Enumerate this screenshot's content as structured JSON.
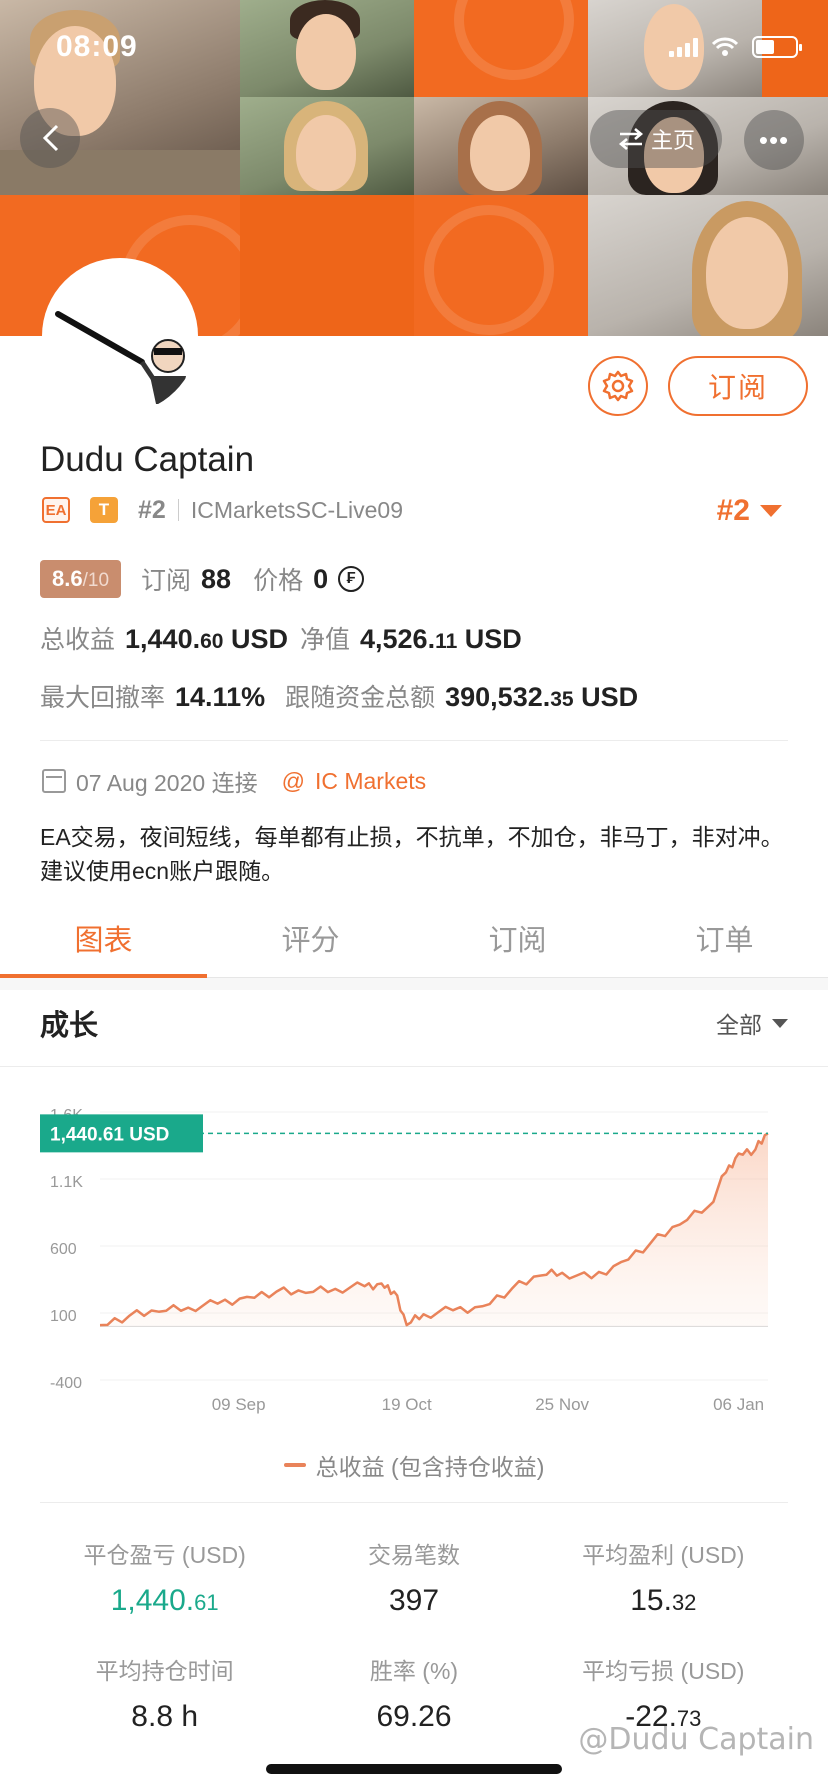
{
  "status_bar": {
    "time": "08:09"
  },
  "banner": {
    "home_label": "主页",
    "accent": "#f26a21"
  },
  "actions": {
    "subscribe_label": "订阅"
  },
  "profile": {
    "name": "Dudu Captain",
    "tag_ea": "EA",
    "tag_t": "T",
    "rank": "#2",
    "server": "ICMarketsSC-Live09",
    "rank_right": "#2",
    "score": "8.6",
    "score_max": "/10",
    "subscribe_label": "订阅",
    "subscribers": "88",
    "price_label": "价格",
    "price": "0",
    "total_profit_label": "总收益",
    "total_profit_main": "1,440.",
    "total_profit_dec": "60",
    "total_profit_unit": "USD",
    "equity_label": "净值",
    "equity_main": "4,526.",
    "equity_dec": "11",
    "equity_unit": "USD",
    "max_drawdown_label": "最大回撤率",
    "max_drawdown": "14.11%",
    "follow_funds_label": "跟随资金总额",
    "follow_funds_main": "390,532.",
    "follow_funds_dec": "35",
    "follow_funds_unit": "USD",
    "connected_date": "07 Aug 2020 连接",
    "broker": "IC Markets",
    "description": "EA交易，夜间短线，每单都有止损，不抗单，不加仓，非马丁，非对冲。建议使用ecn账户跟随。"
  },
  "tabs": [
    {
      "label": "图表",
      "active": true
    },
    {
      "label": "评分",
      "active": false
    },
    {
      "label": "订阅",
      "active": false
    },
    {
      "label": "订单",
      "active": false
    }
  ],
  "growth": {
    "title": "成长",
    "filter_label": "全部"
  },
  "chart_data": {
    "type": "area",
    "ytick_labels": [
      "1.6K",
      "1.1K",
      "600",
      "100",
      "-400"
    ],
    "yticks": [
      1600,
      1100,
      600,
      100,
      -400
    ],
    "ylim": [
      -400,
      1600
    ],
    "xtick_labels": [
      "09 Sep",
      "19 Oct",
      "25 Nov",
      "06 Jan"
    ],
    "current_value_label": "1,440.61 USD",
    "current_value": 1440.61,
    "series": [
      {
        "name": "总收益 (包含持仓收益)",
        "color": "#e9835a",
        "x": [
          "2020-08-07",
          "2020-08-14",
          "2020-08-21",
          "2020-08-28",
          "2020-09-04",
          "2020-09-11",
          "2020-09-18",
          "2020-09-25",
          "2020-10-02",
          "2020-10-09",
          "2020-10-13",
          "2020-10-16",
          "2020-10-19",
          "2020-10-23",
          "2020-10-30",
          "2020-11-06",
          "2020-11-13",
          "2020-11-20",
          "2020-11-25",
          "2020-12-02",
          "2020-12-09",
          "2020-12-16",
          "2020-12-23",
          "2020-12-30",
          "2021-01-03",
          "2021-01-06",
          "2021-01-10",
          "2021-01-13"
        ],
        "values": [
          10,
          80,
          110,
          140,
          170,
          220,
          260,
          250,
          280,
          300,
          320,
          260,
          10,
          90,
          120,
          150,
          280,
          380,
          400,
          360,
          480,
          620,
          760,
          900,
          1150,
          1290,
          1320,
          1440.61
        ]
      }
    ],
    "legend": [
      "总收益 (包含持仓收益)"
    ]
  },
  "stats": [
    {
      "label": "平仓盈亏 (USD)",
      "main": "1,440.",
      "dec": "61",
      "green": true
    },
    {
      "label": "交易笔数",
      "main": "397",
      "dec": "",
      "green": false
    },
    {
      "label": "平均盈利 (USD)",
      "main": "15.",
      "dec": "32",
      "green": false
    },
    {
      "label": "平均持仓时间",
      "main": "8.8 h",
      "dec": "",
      "green": false
    },
    {
      "label": "胜率 (%)",
      "main": "69.26",
      "dec": "",
      "green": false
    },
    {
      "label": "平均亏损 (USD)",
      "main": "-22.",
      "dec": "73",
      "green": false
    }
  ],
  "watermark": "@Dudu Captain"
}
